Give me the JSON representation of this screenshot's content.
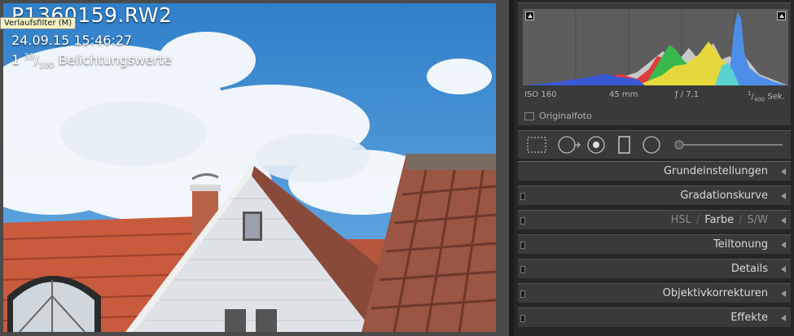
{
  "photo": {
    "filename": "P1360159.RW2",
    "datetime": "24.09.15 15:46:27",
    "exposure_whole": "1",
    "exposure_num": "33",
    "exposure_den": "100",
    "exposure_label": "Belichtungswerte"
  },
  "tooltip": "Verlaufsfilter (M)",
  "histogram": {
    "iso": "ISO 160",
    "focal": "45 mm",
    "aperture": "ƒ / 7,1",
    "shutter_num": "1",
    "shutter_den": "400",
    "shutter_unit": "Sek.",
    "original_photo_label": "Originalfoto"
  },
  "tools": [
    "crop-tool",
    "spot-removal-tool",
    "red-eye-tool",
    "graduated-filter-tool",
    "radial-filter-tool",
    "adjustment-brush-tool"
  ],
  "sections": {
    "basic": "Grundeinstellungen",
    "tone_curve": "Gradationskurve",
    "hsl": "HSL",
    "color": "Farbe",
    "bw": "S/W",
    "split_toning": "Teiltonung",
    "details": "Details",
    "lens": "Objektivkorrekturen",
    "effects": "Effekte"
  },
  "colors": {
    "sky": "#3f8fd4",
    "roof": "#c85a3e",
    "panel_bg": "#3a3a3a",
    "tooltip_bg": "#f6f3c8"
  }
}
